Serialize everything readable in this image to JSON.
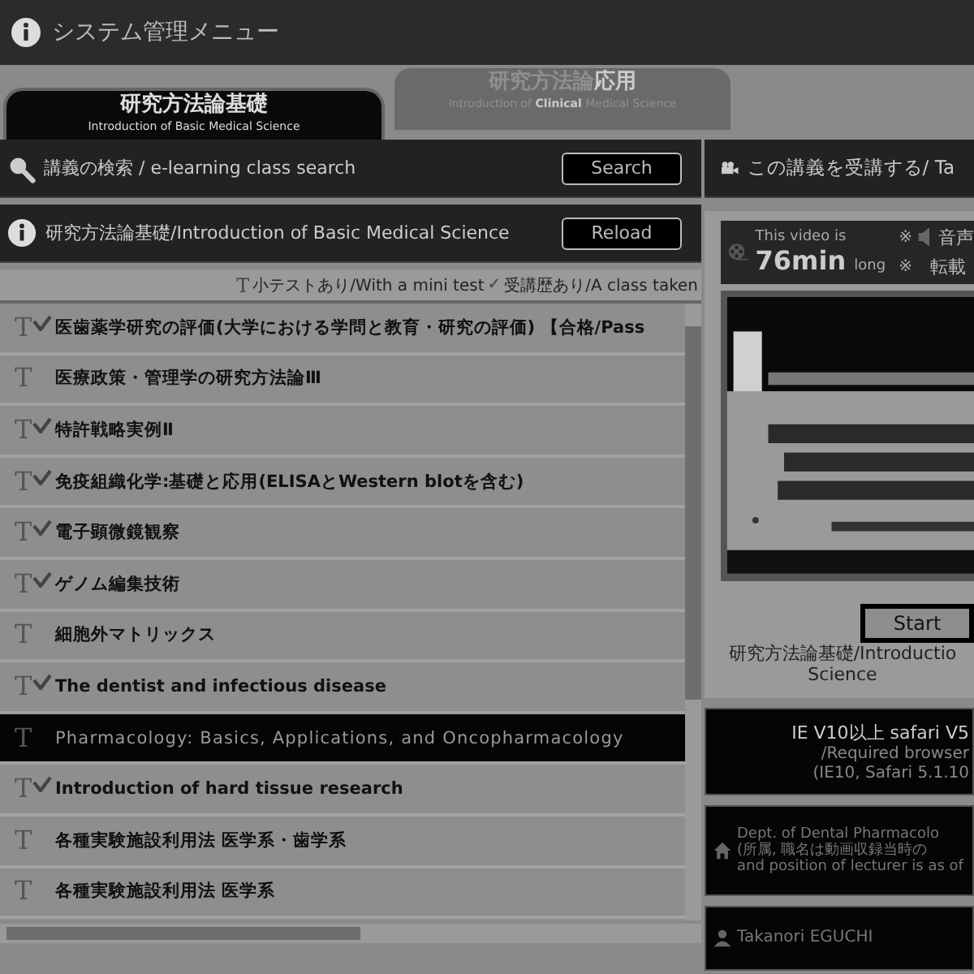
{
  "header": {
    "title": "システム管理メニュー"
  },
  "tabs": [
    {
      "title": "研究方法論基礎",
      "subtitle": "Introduction of Basic Medical Science",
      "selected": true
    },
    {
      "title": "研究方法論**応用**",
      "subtitle": "Introduction of **Clinical** Medical Science",
      "selected": false
    }
  ],
  "search_bar": {
    "label": "講義の検索 / e-learning class search",
    "button": "Search"
  },
  "course_bar": {
    "label": "研究方法論基礎/Introduction of Basic Medical Science",
    "button": "Reload"
  },
  "legend": {
    "mini_test_icon": "T",
    "mini_test": "小テストあり/With a mini test",
    "taken_icon": "✓",
    "taken": "受講歴あり/A class taken"
  },
  "lectures": [
    {
      "mini_test_mark": "T",
      "title": "医歯薬学研究の評価(大学における学問と教育・研究の評価) 【合格/Pass",
      "taken": true,
      "selected": false
    },
    {
      "mini_test_mark": "T",
      "title": "医療政策・管理学の研究方法論Ⅲ",
      "taken": false,
      "selected": false
    },
    {
      "mini_test_mark": "T",
      "title": "特許戦略実例Ⅱ",
      "taken": true,
      "selected": false
    },
    {
      "mini_test_mark": "T",
      "title": "免疫組織化学:基礎と応用(ELISAとWestern blotを含む)",
      "taken": true,
      "selected": false
    },
    {
      "mini_test_mark": "T",
      "title": "電子顕微鏡観察",
      "taken": true,
      "selected": false
    },
    {
      "mini_test_mark": "T",
      "title": "ゲノム編集技術",
      "taken": true,
      "selected": false
    },
    {
      "mini_test_mark": "T",
      "title": "細胞外マトリックス",
      "taken": false,
      "selected": false
    },
    {
      "mini_test_mark": "T",
      "title": "The dentist and infectious disease",
      "taken": true,
      "selected": false
    },
    {
      "mini_test_mark": "T",
      "title": "Pharmacology: Basics, Applications, and Oncopharmacology",
      "taken": false,
      "selected": true
    },
    {
      "mini_test_mark": "T",
      "title": "Introduction of hard tissue research",
      "taken": true,
      "selected": false
    },
    {
      "mini_test_mark": "T",
      "title": "各種実験施設利用法 医学系・歯学系",
      "taken": false,
      "selected": false
    },
    {
      "mini_test_mark": "T",
      "title": "各種実験施設利用法 医学系",
      "taken": false,
      "selected": false
    }
  ],
  "take_panel": {
    "heading": "この講義を受講する/ Ta",
    "video_info": {
      "line1": "This video is",
      "duration": "76min",
      "unit": "long",
      "mark1": "※",
      "audio": "音声",
      "mark2": "※",
      "reprint": "転載"
    },
    "thumbnail": {
      "kind": "picture"
    },
    "start_button": "Start",
    "caption": [
      "研究方法論基礎/Introductio",
      "Science"
    ],
    "browser_box": [
      "IE V10以上 safari V5",
      "/Required browser",
      "(IE10, Safari 5.1.10"
    ],
    "department_box": [
      "Dept. of Dental Pharmacolo",
      "(所属, 職名は動画収録当時の",
      "and position of lecturer is as of"
    ],
    "lecturer": "Takanori EGUCHI"
  }
}
